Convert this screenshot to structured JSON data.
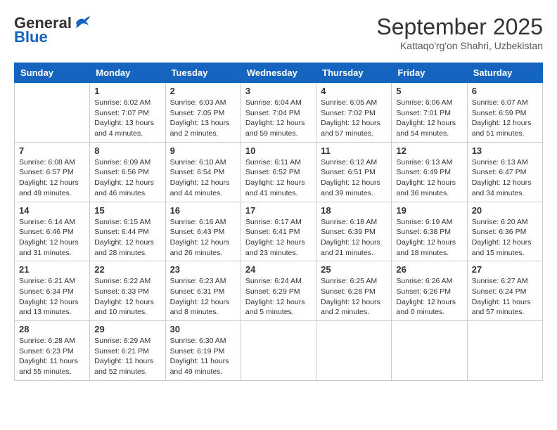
{
  "header": {
    "logo_general": "General",
    "logo_blue": "Blue",
    "month": "September 2025",
    "location": "Kattaqo'rg'on Shahri, Uzbekistan"
  },
  "weekdays": [
    "Sunday",
    "Monday",
    "Tuesday",
    "Wednesday",
    "Thursday",
    "Friday",
    "Saturday"
  ],
  "weeks": [
    [
      {
        "day": "",
        "info": ""
      },
      {
        "day": "1",
        "info": "Sunrise: 6:02 AM\nSunset: 7:07 PM\nDaylight: 13 hours\nand 4 minutes."
      },
      {
        "day": "2",
        "info": "Sunrise: 6:03 AM\nSunset: 7:05 PM\nDaylight: 13 hours\nand 2 minutes."
      },
      {
        "day": "3",
        "info": "Sunrise: 6:04 AM\nSunset: 7:04 PM\nDaylight: 12 hours\nand 59 minutes."
      },
      {
        "day": "4",
        "info": "Sunrise: 6:05 AM\nSunset: 7:02 PM\nDaylight: 12 hours\nand 57 minutes."
      },
      {
        "day": "5",
        "info": "Sunrise: 6:06 AM\nSunset: 7:01 PM\nDaylight: 12 hours\nand 54 minutes."
      },
      {
        "day": "6",
        "info": "Sunrise: 6:07 AM\nSunset: 6:59 PM\nDaylight: 12 hours\nand 51 minutes."
      }
    ],
    [
      {
        "day": "7",
        "info": "Sunrise: 6:08 AM\nSunset: 6:57 PM\nDaylight: 12 hours\nand 49 minutes."
      },
      {
        "day": "8",
        "info": "Sunrise: 6:09 AM\nSunset: 6:56 PM\nDaylight: 12 hours\nand 46 minutes."
      },
      {
        "day": "9",
        "info": "Sunrise: 6:10 AM\nSunset: 6:54 PM\nDaylight: 12 hours\nand 44 minutes."
      },
      {
        "day": "10",
        "info": "Sunrise: 6:11 AM\nSunset: 6:52 PM\nDaylight: 12 hours\nand 41 minutes."
      },
      {
        "day": "11",
        "info": "Sunrise: 6:12 AM\nSunset: 6:51 PM\nDaylight: 12 hours\nand 39 minutes."
      },
      {
        "day": "12",
        "info": "Sunrise: 6:13 AM\nSunset: 6:49 PM\nDaylight: 12 hours\nand 36 minutes."
      },
      {
        "day": "13",
        "info": "Sunrise: 6:13 AM\nSunset: 6:47 PM\nDaylight: 12 hours\nand 34 minutes."
      }
    ],
    [
      {
        "day": "14",
        "info": "Sunrise: 6:14 AM\nSunset: 6:46 PM\nDaylight: 12 hours\nand 31 minutes."
      },
      {
        "day": "15",
        "info": "Sunrise: 6:15 AM\nSunset: 6:44 PM\nDaylight: 12 hours\nand 28 minutes."
      },
      {
        "day": "16",
        "info": "Sunrise: 6:16 AM\nSunset: 6:43 PM\nDaylight: 12 hours\nand 26 minutes."
      },
      {
        "day": "17",
        "info": "Sunrise: 6:17 AM\nSunset: 6:41 PM\nDaylight: 12 hours\nand 23 minutes."
      },
      {
        "day": "18",
        "info": "Sunrise: 6:18 AM\nSunset: 6:39 PM\nDaylight: 12 hours\nand 21 minutes."
      },
      {
        "day": "19",
        "info": "Sunrise: 6:19 AM\nSunset: 6:38 PM\nDaylight: 12 hours\nand 18 minutes."
      },
      {
        "day": "20",
        "info": "Sunrise: 6:20 AM\nSunset: 6:36 PM\nDaylight: 12 hours\nand 15 minutes."
      }
    ],
    [
      {
        "day": "21",
        "info": "Sunrise: 6:21 AM\nSunset: 6:34 PM\nDaylight: 12 hours\nand 13 minutes."
      },
      {
        "day": "22",
        "info": "Sunrise: 6:22 AM\nSunset: 6:33 PM\nDaylight: 12 hours\nand 10 minutes."
      },
      {
        "day": "23",
        "info": "Sunrise: 6:23 AM\nSunset: 6:31 PM\nDaylight: 12 hours\nand 8 minutes."
      },
      {
        "day": "24",
        "info": "Sunrise: 6:24 AM\nSunset: 6:29 PM\nDaylight: 12 hours\nand 5 minutes."
      },
      {
        "day": "25",
        "info": "Sunrise: 6:25 AM\nSunset: 6:28 PM\nDaylight: 12 hours\nand 2 minutes."
      },
      {
        "day": "26",
        "info": "Sunrise: 6:26 AM\nSunset: 6:26 PM\nDaylight: 12 hours\nand 0 minutes."
      },
      {
        "day": "27",
        "info": "Sunrise: 6:27 AM\nSunset: 6:24 PM\nDaylight: 11 hours\nand 57 minutes."
      }
    ],
    [
      {
        "day": "28",
        "info": "Sunrise: 6:28 AM\nSunset: 6:23 PM\nDaylight: 11 hours\nand 55 minutes."
      },
      {
        "day": "29",
        "info": "Sunrise: 6:29 AM\nSunset: 6:21 PM\nDaylight: 11 hours\nand 52 minutes."
      },
      {
        "day": "30",
        "info": "Sunrise: 6:30 AM\nSunset: 6:19 PM\nDaylight: 11 hours\nand 49 minutes."
      },
      {
        "day": "",
        "info": ""
      },
      {
        "day": "",
        "info": ""
      },
      {
        "day": "",
        "info": ""
      },
      {
        "day": "",
        "info": ""
      }
    ]
  ]
}
